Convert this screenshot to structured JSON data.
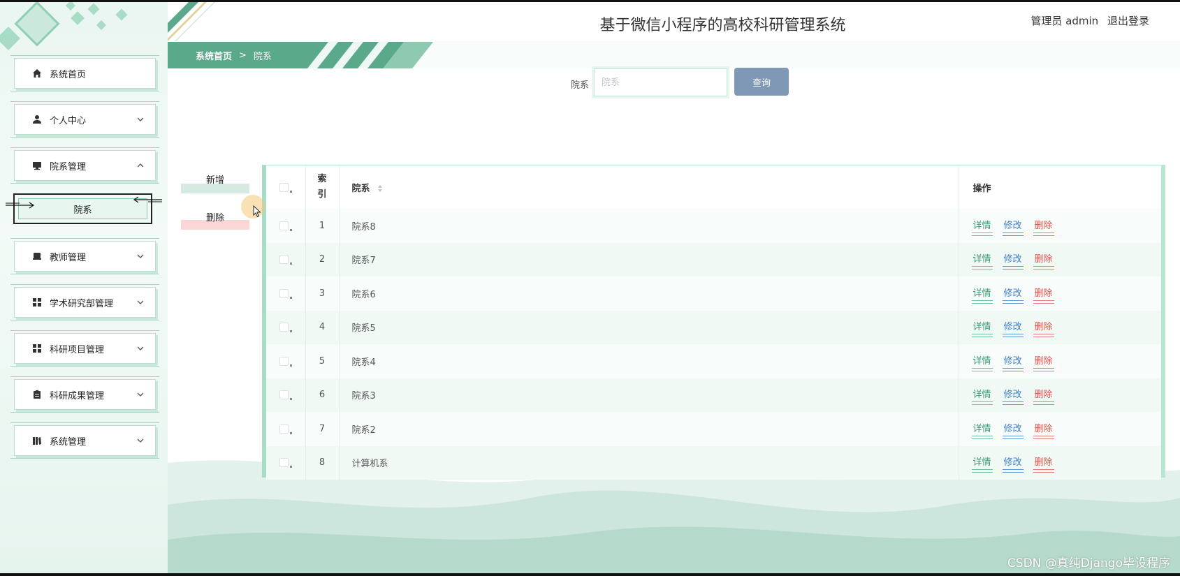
{
  "app": {
    "title": "基于微信小程序的高校科研管理系统",
    "user_label": "管理员 admin",
    "logout_label": "退出登录"
  },
  "breadcrumb": {
    "home": "系统首页",
    "separator": ">",
    "current": "院系"
  },
  "sidebar": {
    "items": [
      {
        "label": "系统首页",
        "icon": "home-icon"
      },
      {
        "label": "个人中心",
        "icon": "user-icon"
      },
      {
        "label": "院系管理",
        "icon": "monitor-icon",
        "expanded": true
      },
      {
        "label": "教师管理",
        "icon": "printer-icon"
      },
      {
        "label": "学术研究部管理",
        "icon": "grid-icon"
      },
      {
        "label": "科研项目管理",
        "icon": "grid-icon"
      },
      {
        "label": "科研成果管理",
        "icon": "clipboard-icon"
      },
      {
        "label": "系统管理",
        "icon": "book-icon"
      }
    ],
    "submenu": {
      "label": "院系"
    }
  },
  "search": {
    "label": "院系",
    "placeholder": "院系",
    "button": "查询"
  },
  "actions": {
    "add": "新增",
    "delete": "删除"
  },
  "table": {
    "headers": {
      "index": "索引",
      "name": "院系",
      "ops": "操作"
    },
    "ops": {
      "detail": "详情",
      "edit": "修改",
      "delete": "删除"
    },
    "rows": [
      {
        "index": "1",
        "name": "院系8"
      },
      {
        "index": "2",
        "name": "院系7"
      },
      {
        "index": "3",
        "name": "院系6"
      },
      {
        "index": "4",
        "name": "院系5"
      },
      {
        "index": "5",
        "name": "院系4"
      },
      {
        "index": "6",
        "name": "院系3"
      },
      {
        "index": "7",
        "name": "院系2"
      },
      {
        "index": "8",
        "name": "计算机系"
      }
    ]
  },
  "watermark": "CSDN @真纯Django毕设程序",
  "colors": {
    "accent": "#5aa98a",
    "search_button": "#7f98b6",
    "detail": "#3a9b74",
    "edit": "#3c7fc9",
    "delete": "#d9534f"
  }
}
